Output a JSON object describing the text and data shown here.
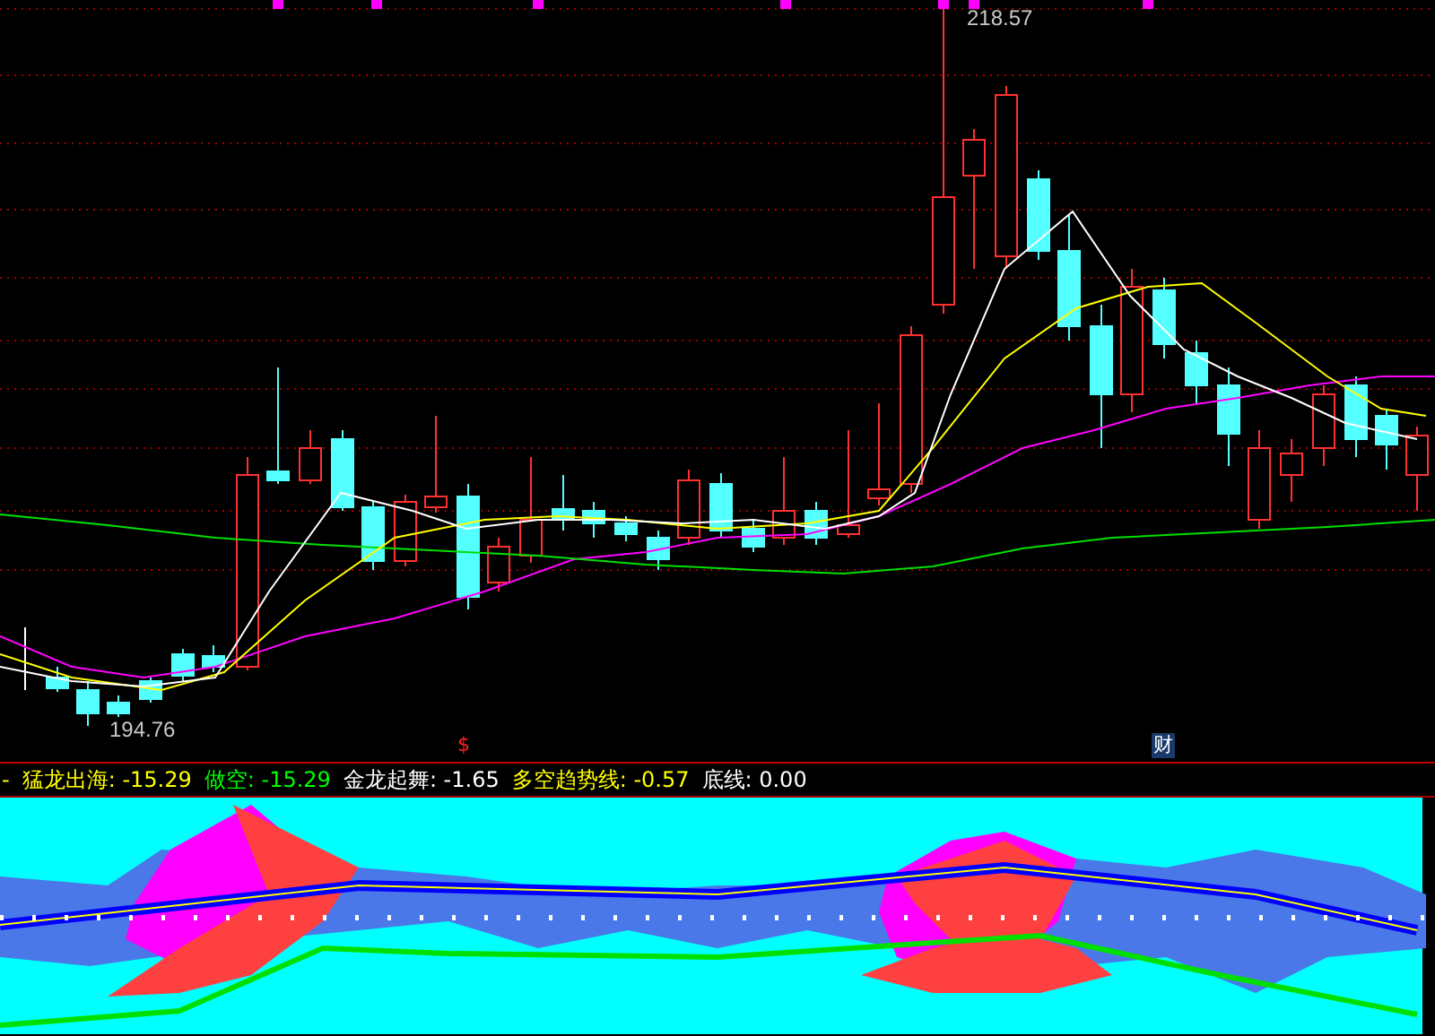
{
  "price_chart": {
    "high_label": "218.57",
    "low_label": "194.76",
    "markers": [
      {
        "kind": "dollar",
        "text": "$"
      },
      {
        "kind": "badge",
        "text": "财"
      }
    ]
  },
  "indicator_legend": {
    "lead": "-",
    "items": [
      {
        "label": "猛龙出海:",
        "value": "-15.29"
      },
      {
        "label": "做空:",
        "value": "-15.29"
      },
      {
        "label": "金龙起舞:",
        "value": "-1.65"
      },
      {
        "label": "多空趋势线:",
        "value": "-0.57"
      },
      {
        "label": "底线:",
        "value": "0.00"
      }
    ]
  }
}
